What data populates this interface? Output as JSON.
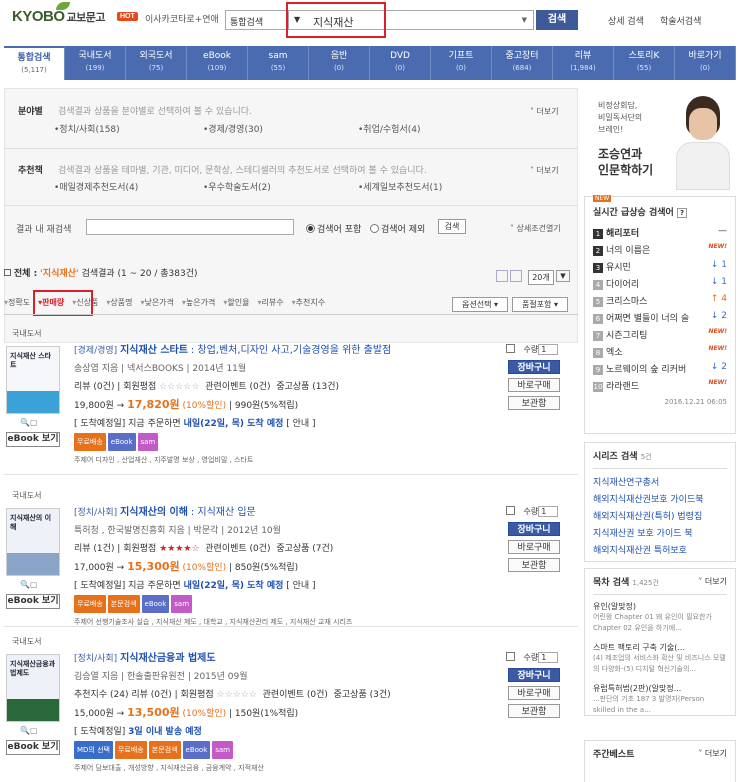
{
  "header": {
    "logo": "KYOBO",
    "logo_sub": "교보문고",
    "hot_badge": "HOT",
    "hot_text": "이사카코타로+연애",
    "search_scope": "통합검색",
    "search_query": "지식재산",
    "search_button": "검색",
    "link_detail": "상세 검색",
    "link_academic": "학술서검색"
  },
  "tabs": [
    {
      "label": "통합검색",
      "count": "(5,117)"
    },
    {
      "label": "국내도서",
      "count": "(199)"
    },
    {
      "label": "외국도서",
      "count": "(75)"
    },
    {
      "label": "eBook",
      "count": "(109)"
    },
    {
      "label": "sam",
      "count": "(55)"
    },
    {
      "label": "음반",
      "count": "(0)"
    },
    {
      "label": "DVD",
      "count": "(0)"
    },
    {
      "label": "기프트",
      "count": "(0)"
    },
    {
      "label": "중고장터",
      "count": "(684)"
    },
    {
      "label": "리뷰",
      "count": "(1,984)"
    },
    {
      "label": "스토리K",
      "count": "(55)"
    },
    {
      "label": "바로가기",
      "count": "(0)"
    }
  ],
  "filters": {
    "category_title": "분야별",
    "category_desc": "검색결과 상품을 분야별로 선택하여 볼 수 있습니다.",
    "category_items": [
      "•정치/사회(158)",
      "•경제/경영(30)",
      "•취업/수험서(4)"
    ],
    "more": "더보기",
    "recommend_title": "추천책",
    "recommend_desc": "검색결과 상품을 테마별, 기관, 미디어, 문학상, 스테디셀러의 추천도서로 선택하여 볼 수 있습니다.",
    "recommend_items": [
      "•매일경제추천도서(4)",
      "•우수학술도서(2)",
      "•세계일보추천도서(1)"
    ],
    "research_title": "결과 내 재검색",
    "radio_include": "검색어 포함",
    "radio_exclude": "검색어 제외",
    "research_button": "검색",
    "advanced": "상세조건열기"
  },
  "result": {
    "label": "전체 :",
    "query": "'지식재산'",
    "summary": "검색결과 (1 ~ 20 / 총383건)",
    "page_size": "20개"
  },
  "sort": {
    "items": [
      "정확도",
      "판매량",
      "신상품",
      "상품명",
      "낮은가격",
      "높은가격",
      "할인율",
      "리뷰수",
      "추천지수"
    ],
    "option_select": "옵션선택",
    "out_of_stock": "품절포함"
  },
  "products": [
    {
      "section": "국내도서",
      "category": "[경제/경영]",
      "title": "지식재산 스타트",
      "subtitle": ": 창업,벤처,디자인 사고,기술경영을 위한 출발점",
      "author": "송상엽 지음 | 넥서스BOOKS | 2014년 11월",
      "review": "리뷰 (0건) | 회원평점",
      "event": "관련이벤트 (0건)",
      "used": "중고상품 (13건)",
      "list_price": "19,800원 →",
      "sale_price": "17,820원",
      "discount": "(10%할인)",
      "points": "| 990원(5%적립)",
      "delivery": "[ 도착예정일] 지금 주문하면",
      "delivery_hl": "내일(22일, 목) 도착 예정",
      "delivery_info": "[ 안내 ]",
      "tags": [
        "무료배송",
        "eBook",
        "sam"
      ],
      "keywords": "주제어  디자인 , 산업재산 , 지주발명 보상 , 영업비밀 , 스타트",
      "cover_text": "지식재산 스타트",
      "ebook": "eBook 보기",
      "stars": "☆☆☆☆☆"
    },
    {
      "section": "국내도서",
      "category": "[정치/사회]",
      "title": "지식재산의 이해",
      "subtitle": ": 지식재산 입문",
      "author": "특허청 , 한국발명진흥회 지음 | 박문각 | 2012년 10월",
      "review": "리뷰 (1건) | 회원평점",
      "event": "관련이벤트 (0건)",
      "used": "중고상품 (7건)",
      "list_price": "17,000원 →",
      "sale_price": "15,300원",
      "discount": "(10%할인)",
      "points": "| 850원(5%적립)",
      "delivery": "[ 도착예정일] 지금 주문하면",
      "delivery_hl": "내일(22일, 목) 도착 예정",
      "delivery_info": "[ 안내 ]",
      "tags": [
        "무료배송",
        "본문검색",
        "eBook",
        "sam"
      ],
      "keywords": "주제어  선행기술조사 실습 , 지식재산 제도 , 대학교 , 지식재산관리 제도 , 지식재산 교재 시리즈",
      "cover_text": "지식재산의 이해",
      "ebook": "eBook 보기",
      "stars": "★★★★☆"
    },
    {
      "section": "국내도서",
      "category": "[정치/사회]",
      "title": "지식재산금융과 법제도",
      "subtitle": "",
      "author": "김승열 지음 | 한솔출판유원전 | 2015년 09월",
      "review": "추천지수 (24) 리뷰 (0건) | 회원평점",
      "event": "관련이벤트 (0건)",
      "used": "중고상품 (3건)",
      "list_price": "15,000원 →",
      "sale_price": "13,500원",
      "discount": "(10%할인)",
      "points": "| 150원(1%적립)",
      "delivery": "[ 도착예정일]",
      "delivery_hl": "3일 이내 발송 예정",
      "delivery_info": "",
      "tags": [
        "MD의 선택",
        "무료배송",
        "본문검색",
        "eBook",
        "sam"
      ],
      "keywords": "주제어  담보대출 , 개성방향 , 지식재산금융 , 금융계약 , 지적재산",
      "cover_text": "지식재산금융과 법제도",
      "ebook": "eBook 보기",
      "stars": "☆☆☆☆☆"
    }
  ],
  "cart": {
    "qty_label": "수량",
    "qty": "1",
    "cart": "장바구니",
    "buy": "바로구매",
    "save": "보관함"
  },
  "banner": {
    "line1": "비정상회담,",
    "line2": "비밀독서단의",
    "line3": "브레인!",
    "title1": "조승연과",
    "title2": "인문학하기"
  },
  "realtime": {
    "new_badge": "NEW",
    "title": "실시간 급상승 검색어",
    "help": "?",
    "items": [
      {
        "rank": "1",
        "term": "해리포터",
        "change": "—",
        "type": "same"
      },
      {
        "rank": "2",
        "term": "너의 이름은",
        "change": "NEW!",
        "type": "new"
      },
      {
        "rank": "3",
        "term": "유시민",
        "change": "↓ 1",
        "type": "down"
      },
      {
        "rank": "4",
        "term": "다이어리",
        "change": "↓ 1",
        "type": "down"
      },
      {
        "rank": "5",
        "term": "크리스마스",
        "change": "↑ 4",
        "type": "up"
      },
      {
        "rank": "6",
        "term": "어쩌면 별들이 너의 슬",
        "change": "↓ 2",
        "type": "down"
      },
      {
        "rank": "7",
        "term": "시즌그리팅",
        "change": "NEW!",
        "type": "new"
      },
      {
        "rank": "8",
        "term": "엑소",
        "change": "NEW!",
        "type": "new"
      },
      {
        "rank": "9",
        "term": "노르웨이의 숲 리커버",
        "change": "↓ 2",
        "type": "down"
      },
      {
        "rank": "10",
        "term": "라라랜드",
        "change": "NEW!",
        "type": "new"
      }
    ],
    "timestamp": "2016.12.21  06:05"
  },
  "series": {
    "title": "시리즈 검색",
    "count": "5건",
    "items": [
      "지식재산연구총서",
      "해외지식재산권보호 가이드북",
      "해외지식재산권(특허) 법령집",
      "지식재산권 보호 가이드 북",
      "해외지식재산권 특허보호"
    ]
  },
  "toc": {
    "title": "목차 검색",
    "count": "1,425건",
    "more": "더보기",
    "items": [
      {
        "head": "유인(알맞정)",
        "body": "어린왕 Chapter 01 왜 유인이 필요한가 Chapter 02 유인을 하기에..."
      },
      {
        "head": "스마트 팩토리 구축 기술(...",
        "body": "(4) 제조업의 서비스화 확산 및 비즈니스 모델의 다양화-(5) 디지털 혁신기술의..."
      },
      {
        "head": "유럽특허법(2판)(알맞정...",
        "body": "...판단의 기초 187 3 발명자(Person skilled in the a..."
      }
    ]
  },
  "weekly": {
    "title": "주간베스트",
    "more": "더보기"
  }
}
